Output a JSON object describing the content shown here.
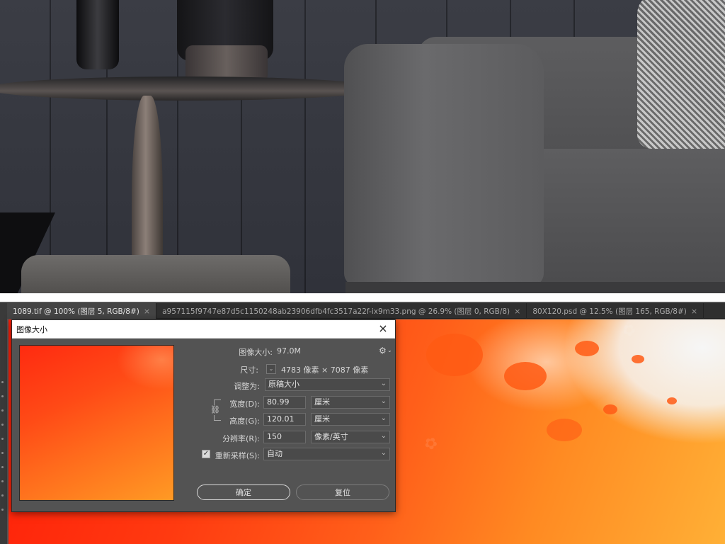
{
  "tabs": [
    {
      "label": "1089.tif @ 100% (图层 5, RGB/8#)",
      "close": "×",
      "active": true
    },
    {
      "label": "a957115f9747e87d5c1150248ab23906dfb4fc3517a22f-ix9m33.png @ 26.9% (图层 0, RGB/8)",
      "close": "×",
      "active": false
    },
    {
      "label": "80X120.psd @ 12.5% (图层 165, RGB/8#)",
      "close": "×",
      "active": false
    }
  ],
  "dialog": {
    "title": "图像大小",
    "close_icon": "×",
    "image_size_label": "图像大小:",
    "image_size_value": "97.0M",
    "gear_icon": "⚙",
    "dimensions_label": "尺寸:",
    "dimensions_dropdown": "⌄",
    "dimensions_value": "4783 像素  ×  7087 像素",
    "fit_to_label": "调整为:",
    "fit_to_value": "原稿大小",
    "width_label": "宽度(D):",
    "width_value": "80.99",
    "width_unit": "厘米",
    "height_label": "高度(G):",
    "height_value": "120.01",
    "height_unit": "厘米",
    "resolution_label": "分辨率(R):",
    "resolution_value": "150",
    "resolution_unit": "像素/英寸",
    "resample_label": "重新采样(S):",
    "resample_checked": true,
    "resample_value": "自动",
    "ok_label": "确定",
    "reset_label": "复位"
  },
  "icons": {
    "chevron": "⌄",
    "link": "⛓",
    "check": "✓"
  }
}
